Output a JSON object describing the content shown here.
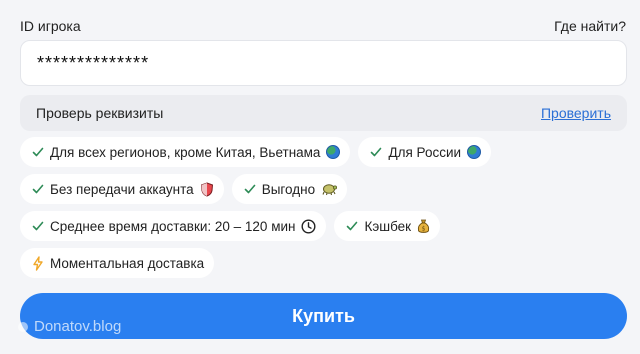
{
  "player_id": {
    "label": "ID игрока",
    "help_link": "Где найти?",
    "value": "**************"
  },
  "verify": {
    "text": "Проверь реквизиты",
    "link": "Проверить"
  },
  "features": [
    {
      "icon": "check-icon",
      "label": "Для всех регионов, кроме Китая, Вьетнама",
      "badge": "globe-icon"
    },
    {
      "icon": "check-icon",
      "label": "Для России",
      "badge": "globe-icon"
    },
    {
      "icon": "check-icon",
      "label": "Без передачи аккаунта",
      "badge": "shield-icon"
    },
    {
      "icon": "check-icon",
      "label": "Выгодно",
      "badge": "turtle-icon"
    },
    {
      "icon": "check-icon",
      "label": "Среднее время доставки: 20 – 120 мин",
      "badge": "clock-icon"
    },
    {
      "icon": "check-icon",
      "label": "Кэшбек",
      "badge": "money-bag-icon"
    },
    {
      "icon": "lightning-icon",
      "label": "Моментальная доставка",
      "badge": ""
    }
  ],
  "buy_button": "Купить",
  "watermark": "Donatov.blog",
  "colors": {
    "accent": "#2a7ff0",
    "link": "#2a6fd6",
    "check": "#2e8b57",
    "background": "#f4f5f8"
  }
}
